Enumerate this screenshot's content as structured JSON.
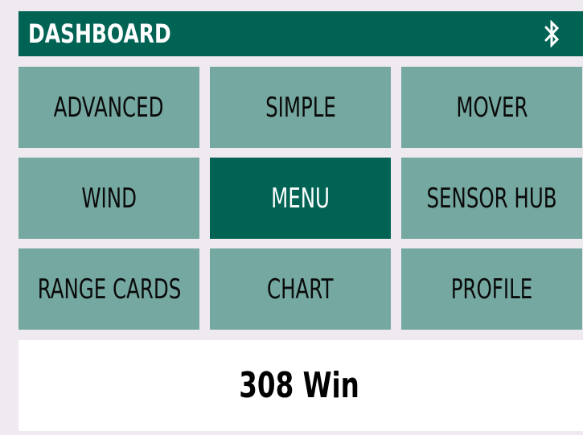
{
  "header": {
    "title": "DASHBOARD",
    "icon": "bluetooth-icon"
  },
  "tiles": [
    {
      "label": "ADVANCED",
      "active": false
    },
    {
      "label": "SIMPLE",
      "active": false
    },
    {
      "label": "MOVER",
      "active": false
    },
    {
      "label": "WIND",
      "active": false
    },
    {
      "label": "MENU",
      "active": true
    },
    {
      "label": "SENSOR HUB",
      "active": false
    },
    {
      "label": "RANGE CARDS",
      "active": false
    },
    {
      "label": "CHART",
      "active": false
    },
    {
      "label": "PROFILE",
      "active": false
    }
  ],
  "footer": {
    "profile_name": "308 Win"
  },
  "colors": {
    "primary": "#006354",
    "tile": "#74a8a0",
    "background": "#efe9f0"
  }
}
